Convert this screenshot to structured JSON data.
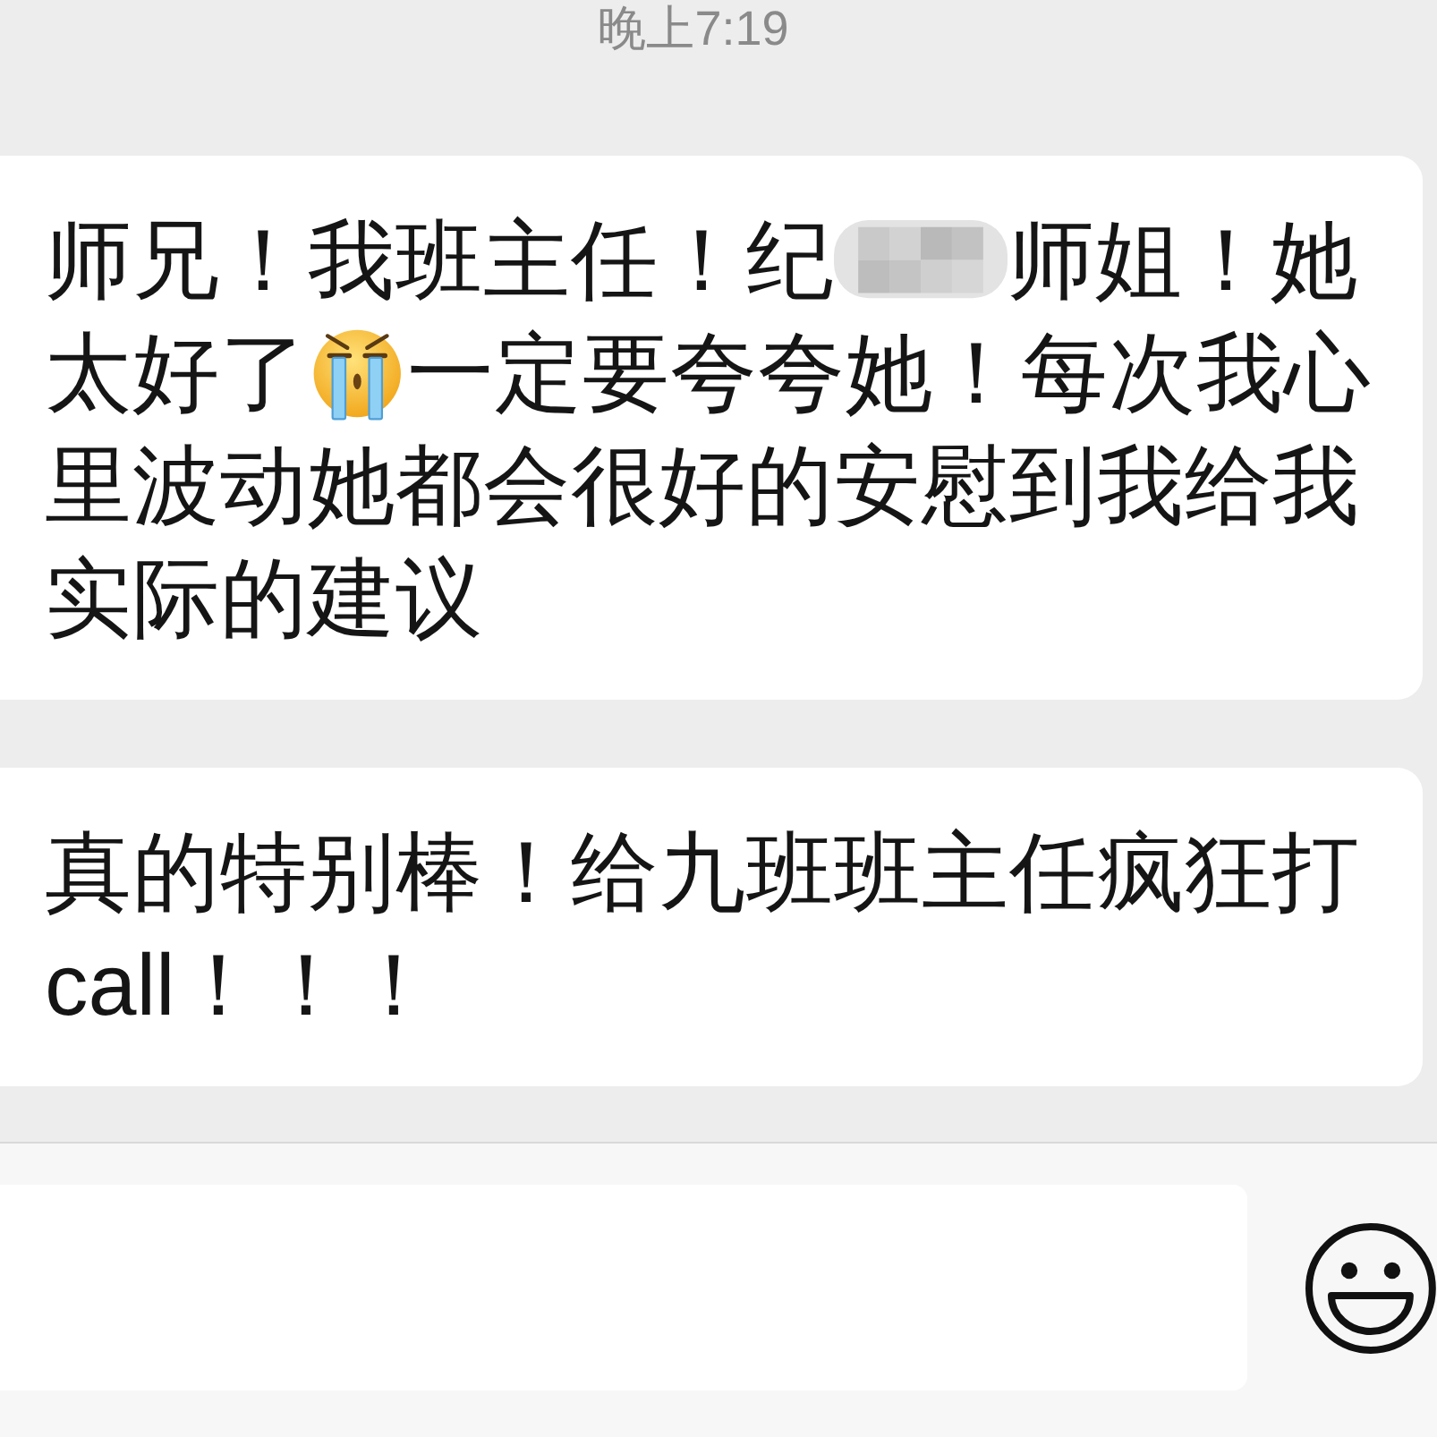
{
  "timestamp": "晚上7:19",
  "messages": [
    {
      "lines": [
        [
          {
            "kind": "text",
            "text": "师兄！我班主任！纪"
          },
          {
            "kind": "redaction"
          },
          {
            "kind": "text",
            "text": "师姐！她"
          }
        ],
        [
          {
            "kind": "text",
            "text": "太好了"
          },
          {
            "kind": "emoji"
          },
          {
            "kind": "text",
            "text": "一定要夸夸她！每次我心"
          }
        ],
        [
          {
            "kind": "text",
            "text": "里波动她都会很好的安慰到我给我"
          }
        ],
        [
          {
            "kind": "text",
            "text": "实际的建议"
          }
        ]
      ]
    },
    {
      "lines": [
        [
          {
            "kind": "text",
            "text": "真的特别棒！给九班班主任疯狂打"
          }
        ],
        [
          {
            "kind": "text",
            "text": "call！！！"
          }
        ]
      ]
    }
  ]
}
